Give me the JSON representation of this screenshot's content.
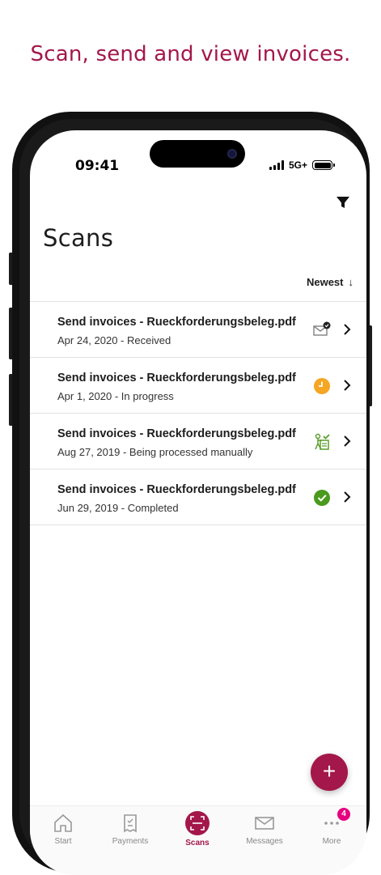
{
  "headline": "Scan, send and view invoices.",
  "status_bar": {
    "time": "09:41",
    "network": "5G+"
  },
  "page": {
    "title": "Scans",
    "sort_label": "Newest",
    "sort_arrow": "↓"
  },
  "scans": [
    {
      "title": "Send invoices - Rueckforderungsbeleg.pdf",
      "subtitle": "Apr 24, 2020 - Received",
      "status_icon": "envelope-check-icon"
    },
    {
      "title": "Send invoices - Rueckforderungsbeleg.pdf",
      "subtitle": "Apr 1, 2020 - In progress",
      "status_icon": "clock-icon"
    },
    {
      "title": "Send invoices - Rueckforderungsbeleg.pdf",
      "subtitle": "Aug 27, 2019 - Being processed manually",
      "status_icon": "person-document-icon"
    },
    {
      "title": "Send invoices - Rueckforderungsbeleg.pdf",
      "subtitle": "Jun 29, 2019 - Completed",
      "status_icon": "check-circle-icon"
    }
  ],
  "fab": {
    "label": "+"
  },
  "nav": {
    "items": [
      {
        "label": "Start",
        "icon": "home-icon"
      },
      {
        "label": "Payments",
        "icon": "receipt-icon"
      },
      {
        "label": "Scans",
        "icon": "scan-icon",
        "active": true
      },
      {
        "label": "Messages",
        "icon": "envelope-icon"
      },
      {
        "label": "More",
        "icon": "more-icon",
        "badge": "4"
      }
    ]
  },
  "colors": {
    "brand": "#a3174a",
    "in_progress": "#f5a623",
    "completed": "#4a9a1e",
    "manual": "#5a9e2a",
    "badge": "#e6007e"
  }
}
